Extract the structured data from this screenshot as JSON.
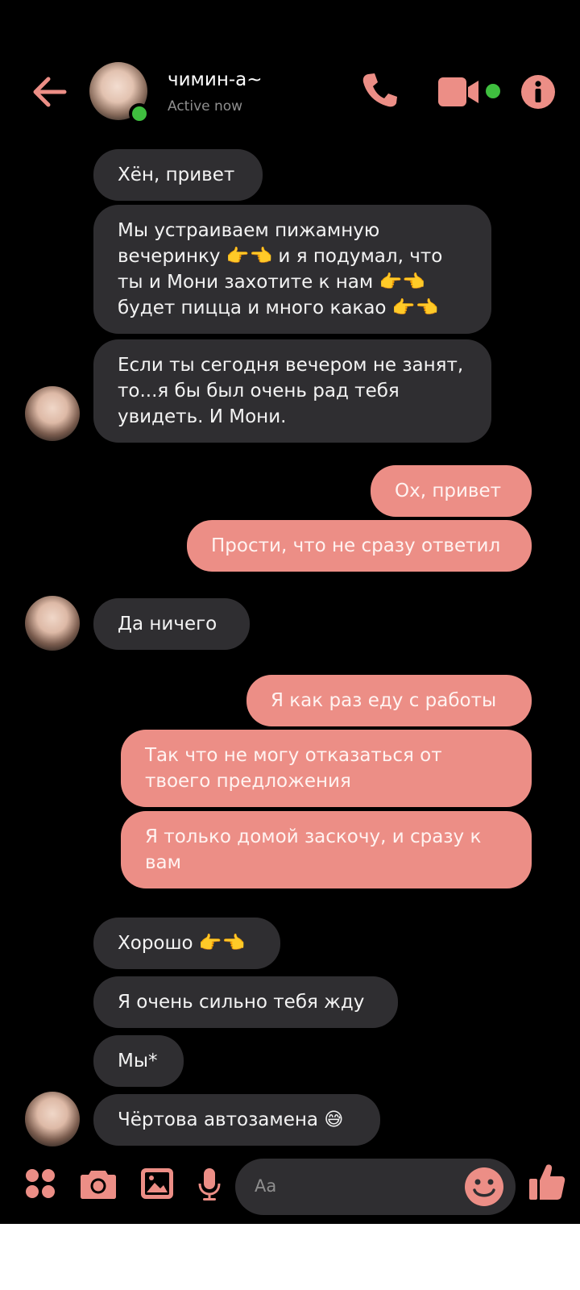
{
  "header": {
    "name": "чимин-а~",
    "status": "Active now"
  },
  "composer": {
    "placeholder": "Aa"
  },
  "colors": {
    "accent": "#ec8e86",
    "incoming_bubble": "#2f2e31",
    "online": "#3fbf3f"
  },
  "messages": [
    {
      "from": "them",
      "text": "Хён, привет"
    },
    {
      "from": "them",
      "text": "Мы устраиваем пижамную вечеринку 👉👈 и я подумал, что ты и Мони захотите к нам 👉👈 будет пицца и много какао 👉👈"
    },
    {
      "from": "them",
      "text": "Если ты сегодня вечером не занят, то...я бы был очень рад тебя увидеть. И Мони."
    },
    {
      "from": "me",
      "text": "Ох, привет"
    },
    {
      "from": "me",
      "text": "Прости, что не сразу ответил"
    },
    {
      "from": "them",
      "text": "Да ничего"
    },
    {
      "from": "me",
      "text": "Я как раз еду с работы"
    },
    {
      "from": "me",
      "text": "Так что не могу отказаться от твоего предложения"
    },
    {
      "from": "me",
      "text": "Я только домой заскочу, и сразу к вам"
    },
    {
      "from": "them",
      "text": "Хорошо 👉👈"
    },
    {
      "from": "them",
      "text": "Я очень сильно тебя жду"
    },
    {
      "from": "them",
      "text": "Мы*"
    },
    {
      "from": "them",
      "text": "Чёртова автозамена 😅"
    }
  ]
}
